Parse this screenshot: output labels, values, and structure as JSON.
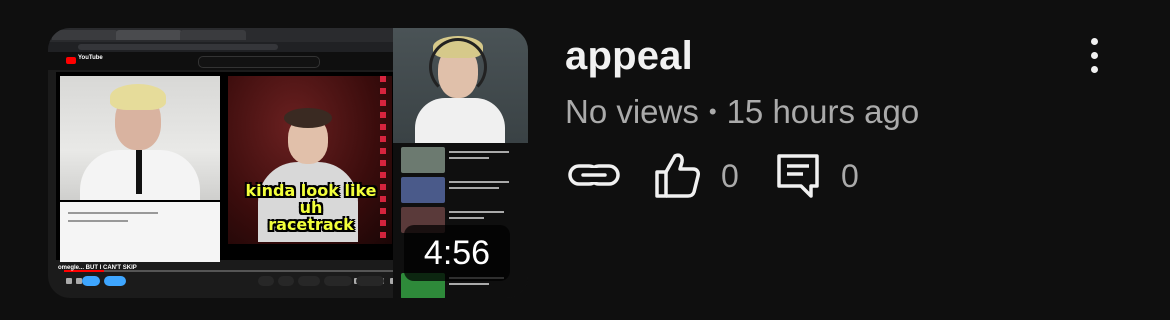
{
  "video": {
    "title": "appeal",
    "views": "No views",
    "separator": "•",
    "age": "15 hours ago",
    "duration": "4:56"
  },
  "thumbnail": {
    "caption_line1": "kinda look like uh",
    "caption_line2": "racetrack",
    "yt_wordmark": "YouTube",
    "under_video_title": "omegle... BUT I CAN'T SKIP"
  },
  "actions": {
    "link_icon": "link-icon",
    "like_icon": "thumbs-up-icon",
    "like_count": "0",
    "comment_icon": "comment-icon",
    "comment_count": "0"
  },
  "menu": {
    "icon": "more-vertical-icon"
  },
  "colors": {
    "background": "#0f0f0f",
    "title_text": "#f1f1f1",
    "secondary_text": "#aaaaaa",
    "caption_yellow": "#f2ff3a"
  }
}
